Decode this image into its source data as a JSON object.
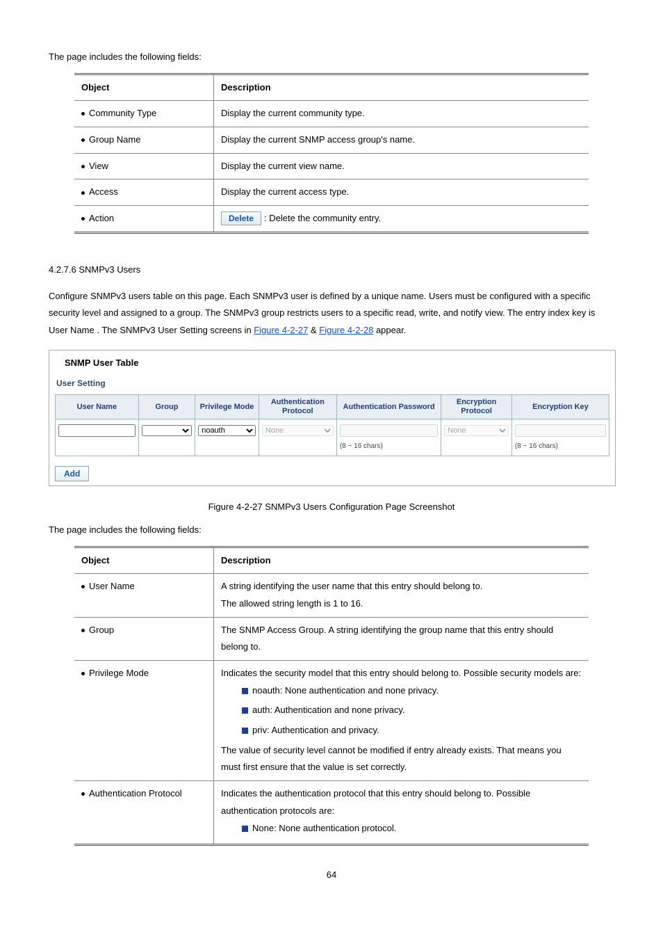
{
  "intro1": "The page includes the following fields:",
  "table1": {
    "h1": "Object",
    "h2": "Description",
    "rows": [
      {
        "label": "Community Type",
        "desc": "Display the current community type."
      },
      {
        "label": "Group Name",
        "desc": "Display the current SNMP access group's name."
      },
      {
        "label": "View",
        "desc": "Display the current view name."
      },
      {
        "label": "Access",
        "desc": "Display the current access type."
      }
    ],
    "actionLabel": "Action",
    "deleteBtn": "Delete",
    "deleteDesc": ": Delete the community entry."
  },
  "section": "4.2.7.6 SNMPv3 Users",
  "para": {
    "a": "Configure SNMPv3 users table on this page. Each SNMPv3 user is defined by a unique name. Users must be configured with a specific security level and assigned to a group. The SNMPv3 group restricts users to a specific read, write, and notify view. The entry index key is ",
    "b": "User Name",
    "c": ". The SNMPv3 User Setting screens in ",
    "linkA": "Figure 4-2-27",
    "amp": " & ",
    "linkB": "Figure 4-2-28",
    "d": " appear."
  },
  "widget": {
    "title": "SNMP User Table",
    "sub": "User Setting",
    "headers": [
      "User Name",
      "Group",
      "Privilege Mode",
      "Authentication Protocol",
      "Authentication Password",
      "Encryption Protocol",
      "Encryption Key"
    ],
    "privOpt": "noauth",
    "authOpt": "None",
    "encOpt": "None",
    "hint": "(8 ~ 16 chars)",
    "addBtn": "Add"
  },
  "figCaption": "Figure 4-2-27 SNMPv3 Users Configuration Page Screenshot",
  "intro2": "The page includes the following fields:",
  "table2": {
    "h1": "Object",
    "h2": "Description",
    "r1": {
      "label": "User Name",
      "l1": "A string identifying the user name that this entry should belong to.",
      "l2": "The allowed string length is 1 to 16."
    },
    "r2": {
      "label": "Group",
      "l1": "The SNMP Access Group. A string identifying the group name that this entry should belong to."
    },
    "r3": {
      "label": "Privilege Mode",
      "l1": "Indicates the security model that this entry should belong to. Possible security models are:",
      "o1a": "noauth",
      "o1b": ": None authentication and none privacy.",
      "o2a": "auth",
      "o2b": ": Authentication and none privacy.",
      "o3a": "priv",
      "o3b": ": Authentication and privacy.",
      "l2": "The value of security level cannot be modified if entry already exists. That means you must first ensure that the value is set correctly."
    },
    "r4": {
      "label": "Authentication Protocol",
      "l1": "Indicates the authentication protocol that this entry should belong to. Possible authentication protocols are:",
      "o1a": "None",
      "o1b": ": None authentication protocol."
    }
  },
  "pageNum": "64"
}
